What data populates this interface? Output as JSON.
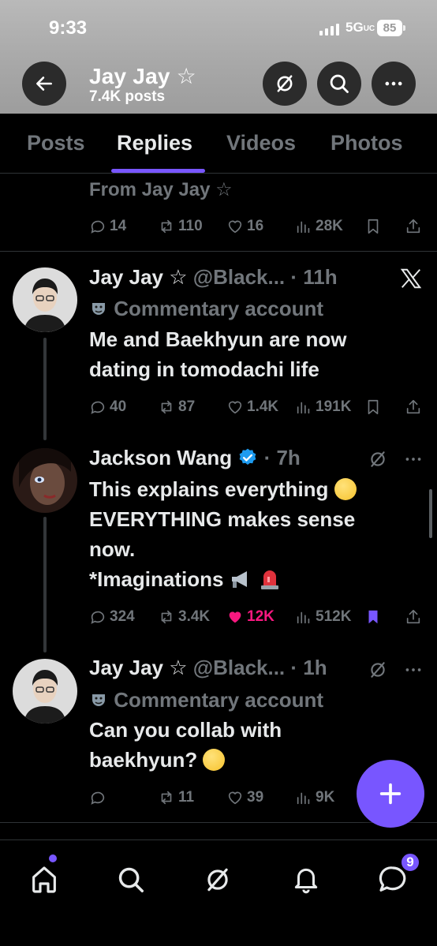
{
  "status_bar": {
    "time": "9:33",
    "network": "5G",
    "network_sub": "UC",
    "battery": "85"
  },
  "profile": {
    "name": "Jay Jay ☆",
    "posts_count": "7.4K posts"
  },
  "tabs": [
    {
      "label": "Posts"
    },
    {
      "label": "Replies"
    },
    {
      "label": "Videos"
    },
    {
      "label": "Photos"
    }
  ],
  "previous_post": {
    "source_line": "From Jay Jay ☆",
    "replies": "14",
    "reposts": "110",
    "likes": "16",
    "views": "28K"
  },
  "posts": [
    {
      "author": "Jay Jay ☆",
      "handle_time": "@Black... · 11h",
      "badge_label": "Commentary account",
      "text_lines": [
        "Me and Baekhyun are now",
        "dating in tomodachi life"
      ],
      "replies": "40",
      "reposts": "87",
      "likes": "1.4K",
      "views": "191K"
    },
    {
      "author": "Jackson Wang",
      "time": "· 7h",
      "text_lines": [
        "This explains everything",
        "EVERYTHING makes sense",
        "now.",
        "*Imaginations"
      ],
      "replies": "324",
      "reposts": "3.4K",
      "likes": "12K",
      "views": "512K",
      "liked": true,
      "bookmarked": true
    },
    {
      "author": "Jay Jay ☆",
      "handle_time": "@Black... · 1h",
      "badge_label": "Commentary account",
      "text_lines": [
        "Can you collab with",
        "baekhyun?"
      ],
      "replies": "",
      "reposts": "11",
      "likes": "39",
      "views": "9K"
    }
  ],
  "bottom_nav": {
    "messages_badge": "9"
  },
  "colors": {
    "accent": "#7856ff",
    "like": "#f91880",
    "verified": "#1d9bf0",
    "muted": "#71767b"
  }
}
